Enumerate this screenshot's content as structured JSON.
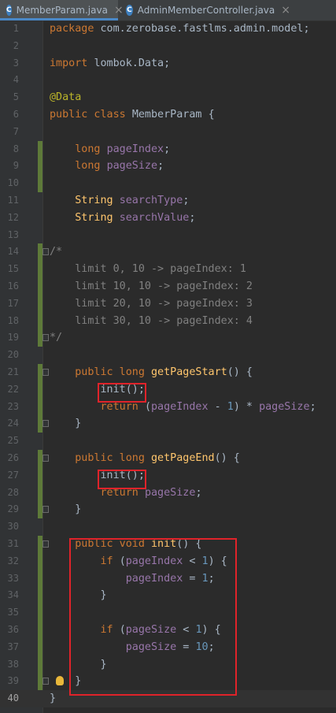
{
  "tabs": [
    {
      "icon": "C",
      "label": "MemberParam.java",
      "close": "×",
      "active": true
    },
    {
      "icon": "C",
      "label": "AdminMemberController.java",
      "close": "×",
      "active": false
    }
  ],
  "colors": {
    "keyword": "#cc7832",
    "annotation": "#bbb529",
    "field": "#9876aa",
    "number": "#6897bb",
    "comment": "#808080",
    "method": "#ffc66d",
    "highlight_box": "#e0232a"
  },
  "editor": {
    "current_line": 40,
    "lines": [
      {
        "n": "1",
        "t": [
          [
            "kw",
            "package "
          ],
          [
            "txt",
            "com.zerobase.fastlms.admin.model;"
          ]
        ]
      },
      {
        "n": "2",
        "t": []
      },
      {
        "n": "3",
        "t": [
          [
            "kw",
            "import "
          ],
          [
            "txt",
            "lombok.Data;"
          ]
        ]
      },
      {
        "n": "4",
        "t": []
      },
      {
        "n": "5",
        "t": [
          [
            "ann",
            "@Data"
          ]
        ]
      },
      {
        "n": "6",
        "t": [
          [
            "kw",
            "public class "
          ],
          [
            "txt",
            "MemberParam "
          ],
          [
            "txt",
            "{"
          ]
        ]
      },
      {
        "n": "7",
        "t": []
      },
      {
        "n": "8",
        "t": [
          [
            "kw",
            "    long "
          ],
          [
            "field",
            "pageIndex"
          ],
          [
            "txt",
            ";"
          ]
        ]
      },
      {
        "n": "9",
        "t": [
          [
            "kw",
            "    long "
          ],
          [
            "field",
            "pageSize"
          ],
          [
            "txt",
            ";"
          ]
        ]
      },
      {
        "n": "10",
        "t": []
      },
      {
        "n": "11",
        "t": [
          [
            "fn",
            "    String "
          ],
          [
            "field",
            "searchType"
          ],
          [
            "txt",
            ";"
          ]
        ]
      },
      {
        "n": "12",
        "t": [
          [
            "fn",
            "    String "
          ],
          [
            "field",
            "searchValue"
          ],
          [
            "txt",
            ";"
          ]
        ]
      },
      {
        "n": "13",
        "t": []
      },
      {
        "n": "14",
        "t": [
          [
            "cm",
            "/*"
          ]
        ]
      },
      {
        "n": "15",
        "t": [
          [
            "cm",
            "    limit 0, 10 -> pageIndex: 1"
          ]
        ]
      },
      {
        "n": "16",
        "t": [
          [
            "cm",
            "    limit 10, 10 -> pageIndex: 2"
          ]
        ]
      },
      {
        "n": "17",
        "t": [
          [
            "cm",
            "    limit 20, 10 -> pageIndex: 3"
          ]
        ]
      },
      {
        "n": "18",
        "t": [
          [
            "cm",
            "    limit 30, 10 -> pageIndex: 4"
          ]
        ]
      },
      {
        "n": "19",
        "t": [
          [
            "cm",
            "*/"
          ]
        ]
      },
      {
        "n": "20",
        "t": []
      },
      {
        "n": "21",
        "t": [
          [
            "kw",
            "    public long "
          ],
          [
            "fn",
            "getPageStart"
          ],
          [
            "txt",
            "() {"
          ]
        ]
      },
      {
        "n": "22",
        "t": [
          [
            "txt",
            "        init();"
          ]
        ]
      },
      {
        "n": "23",
        "t": [
          [
            "kw",
            "        return "
          ],
          [
            "txt",
            "("
          ],
          [
            "field",
            "pageIndex"
          ],
          [
            "txt",
            " - "
          ],
          [
            "num",
            "1"
          ],
          [
            "txt",
            ") * "
          ],
          [
            "field",
            "pageSize"
          ],
          [
            "txt",
            ";"
          ]
        ]
      },
      {
        "n": "24",
        "t": [
          [
            "txt",
            "    }"
          ]
        ]
      },
      {
        "n": "25",
        "t": []
      },
      {
        "n": "26",
        "t": [
          [
            "kw",
            "    public long "
          ],
          [
            "fn",
            "getPageEnd"
          ],
          [
            "txt",
            "() {"
          ]
        ]
      },
      {
        "n": "27",
        "t": [
          [
            "txt",
            "        init();"
          ]
        ]
      },
      {
        "n": "28",
        "t": [
          [
            "kw",
            "        return "
          ],
          [
            "field",
            "pageSize"
          ],
          [
            "txt",
            ";"
          ]
        ]
      },
      {
        "n": "29",
        "t": [
          [
            "txt",
            "    }"
          ]
        ]
      },
      {
        "n": "30",
        "t": []
      },
      {
        "n": "31",
        "t": [
          [
            "kw",
            "    public void "
          ],
          [
            "fn",
            "init"
          ],
          [
            "txt",
            "() {"
          ]
        ]
      },
      {
        "n": "32",
        "t": [
          [
            "kw",
            "        if "
          ],
          [
            "txt",
            "("
          ],
          [
            "field",
            "pageIndex"
          ],
          [
            "txt",
            " < "
          ],
          [
            "num",
            "1"
          ],
          [
            "txt",
            ") {"
          ]
        ]
      },
      {
        "n": "33",
        "t": [
          [
            "field",
            "            pageIndex"
          ],
          [
            "txt",
            " = "
          ],
          [
            "num",
            "1"
          ],
          [
            "txt",
            ";"
          ]
        ]
      },
      {
        "n": "34",
        "t": [
          [
            "txt",
            "        }"
          ]
        ]
      },
      {
        "n": "35",
        "t": []
      },
      {
        "n": "36",
        "t": [
          [
            "kw",
            "        if "
          ],
          [
            "txt",
            "("
          ],
          [
            "field",
            "pageSize"
          ],
          [
            "txt",
            " < "
          ],
          [
            "num",
            "1"
          ],
          [
            "txt",
            ") {"
          ]
        ]
      },
      {
        "n": "37",
        "t": [
          [
            "field",
            "            pageSize"
          ],
          [
            "txt",
            " = "
          ],
          [
            "num",
            "10"
          ],
          [
            "txt",
            ";"
          ]
        ]
      },
      {
        "n": "38",
        "t": [
          [
            "txt",
            "        }"
          ]
        ]
      },
      {
        "n": "39",
        "t": [
          [
            "txt",
            "    }"
          ]
        ]
      },
      {
        "n": "40",
        "t": [
          [
            "txt",
            "}"
          ]
        ]
      }
    ]
  }
}
